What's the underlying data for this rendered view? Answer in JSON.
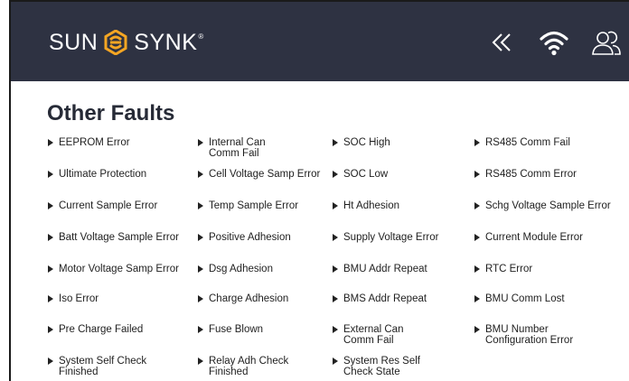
{
  "header": {
    "brand_left": "SUN",
    "brand_right": "SYNK",
    "registered": "®",
    "icons": [
      "back-chevron-icon",
      "wifi-icon",
      "users-icon"
    ],
    "colors": {
      "bar": "#2e3242",
      "accent": "#f5a623"
    }
  },
  "page": {
    "title": "Other Faults"
  },
  "faults": [
    [
      "EEPROM Error",
      "Internal Can\nComm Fail",
      "SOC High",
      "RS485 Comm Fail"
    ],
    [
      "Ultimate Protection",
      "Cell Voltage Samp Error",
      "SOC Low",
      "RS485 Comm Error"
    ],
    [
      "Current Sample Error",
      "Temp Sample Error",
      "Ht Adhesion",
      "Schg Voltage Sample Error"
    ],
    [
      "Batt Voltage Sample Error",
      "Positive Adhesion",
      "Supply Voltage Error",
      "Current Module Error"
    ],
    [
      "Motor Voltage Samp Error",
      "Dsg Adhesion",
      "BMU Addr Repeat",
      "RTC Error"
    ],
    [
      "Iso Error",
      "Charge Adhesion",
      "BMS Addr Repeat",
      "BMU Comm Lost"
    ],
    [
      "Pre Charge Failed",
      "Fuse Blown",
      "External Can\nComm Fail",
      "BMU Number\nConfiguration Error"
    ],
    [
      "System Self Check\nFinished",
      "Relay Adh Check\nFinished",
      "System Res Self\nCheck State",
      ""
    ]
  ]
}
